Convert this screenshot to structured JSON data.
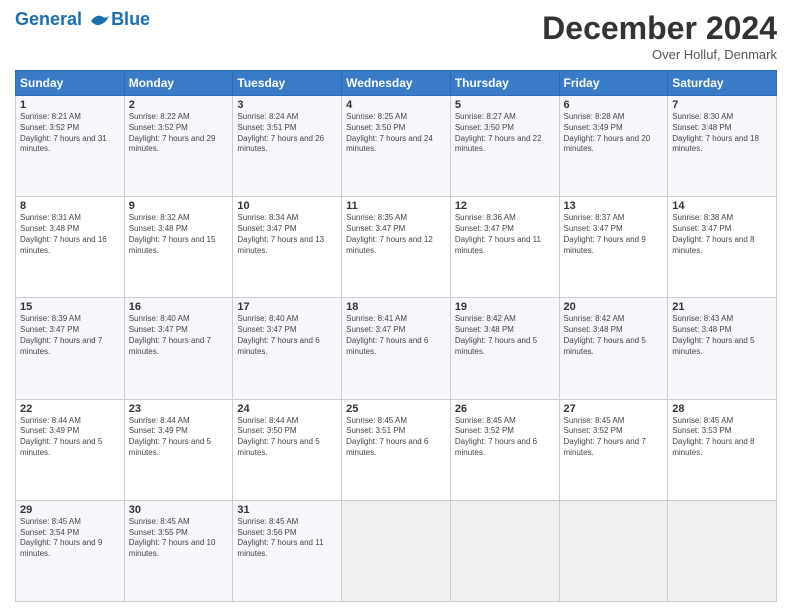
{
  "header": {
    "logo_line1": "General",
    "logo_line2": "Blue",
    "month_title": "December 2024",
    "location": "Over Holluf, Denmark"
  },
  "days_of_week": [
    "Sunday",
    "Monday",
    "Tuesday",
    "Wednesday",
    "Thursday",
    "Friday",
    "Saturday"
  ],
  "weeks": [
    [
      {
        "day": "1",
        "sunrise": "8:21 AM",
        "sunset": "3:52 PM",
        "daylight": "7 hours and 31 minutes."
      },
      {
        "day": "2",
        "sunrise": "8:22 AM",
        "sunset": "3:52 PM",
        "daylight": "7 hours and 29 minutes."
      },
      {
        "day": "3",
        "sunrise": "8:24 AM",
        "sunset": "3:51 PM",
        "daylight": "7 hours and 26 minutes."
      },
      {
        "day": "4",
        "sunrise": "8:25 AM",
        "sunset": "3:50 PM",
        "daylight": "7 hours and 24 minutes."
      },
      {
        "day": "5",
        "sunrise": "8:27 AM",
        "sunset": "3:50 PM",
        "daylight": "7 hours and 22 minutes."
      },
      {
        "day": "6",
        "sunrise": "8:28 AM",
        "sunset": "3:49 PM",
        "daylight": "7 hours and 20 minutes."
      },
      {
        "day": "7",
        "sunrise": "8:30 AM",
        "sunset": "3:48 PM",
        "daylight": "7 hours and 18 minutes."
      }
    ],
    [
      {
        "day": "8",
        "sunrise": "8:31 AM",
        "sunset": "3:48 PM",
        "daylight": "7 hours and 16 minutes."
      },
      {
        "day": "9",
        "sunrise": "8:32 AM",
        "sunset": "3:48 PM",
        "daylight": "7 hours and 15 minutes."
      },
      {
        "day": "10",
        "sunrise": "8:34 AM",
        "sunset": "3:47 PM",
        "daylight": "7 hours and 13 minutes."
      },
      {
        "day": "11",
        "sunrise": "8:35 AM",
        "sunset": "3:47 PM",
        "daylight": "7 hours and 12 minutes."
      },
      {
        "day": "12",
        "sunrise": "8:36 AM",
        "sunset": "3:47 PM",
        "daylight": "7 hours and 11 minutes."
      },
      {
        "day": "13",
        "sunrise": "8:37 AM",
        "sunset": "3:47 PM",
        "daylight": "7 hours and 9 minutes."
      },
      {
        "day": "14",
        "sunrise": "8:38 AM",
        "sunset": "3:47 PM",
        "daylight": "7 hours and 8 minutes."
      }
    ],
    [
      {
        "day": "15",
        "sunrise": "8:39 AM",
        "sunset": "3:47 PM",
        "daylight": "7 hours and 7 minutes."
      },
      {
        "day": "16",
        "sunrise": "8:40 AM",
        "sunset": "3:47 PM",
        "daylight": "7 hours and 7 minutes."
      },
      {
        "day": "17",
        "sunrise": "8:40 AM",
        "sunset": "3:47 PM",
        "daylight": "7 hours and 6 minutes."
      },
      {
        "day": "18",
        "sunrise": "8:41 AM",
        "sunset": "3:47 PM",
        "daylight": "7 hours and 6 minutes."
      },
      {
        "day": "19",
        "sunrise": "8:42 AM",
        "sunset": "3:48 PM",
        "daylight": "7 hours and 5 minutes."
      },
      {
        "day": "20",
        "sunrise": "8:42 AM",
        "sunset": "3:48 PM",
        "daylight": "7 hours and 5 minutes."
      },
      {
        "day": "21",
        "sunrise": "8:43 AM",
        "sunset": "3:48 PM",
        "daylight": "7 hours and 5 minutes."
      }
    ],
    [
      {
        "day": "22",
        "sunrise": "8:44 AM",
        "sunset": "3:49 PM",
        "daylight": "7 hours and 5 minutes."
      },
      {
        "day": "23",
        "sunrise": "8:44 AM",
        "sunset": "3:49 PM",
        "daylight": "7 hours and 5 minutes."
      },
      {
        "day": "24",
        "sunrise": "8:44 AM",
        "sunset": "3:50 PM",
        "daylight": "7 hours and 5 minutes."
      },
      {
        "day": "25",
        "sunrise": "8:45 AM",
        "sunset": "3:51 PM",
        "daylight": "7 hours and 6 minutes."
      },
      {
        "day": "26",
        "sunrise": "8:45 AM",
        "sunset": "3:52 PM",
        "daylight": "7 hours and 6 minutes."
      },
      {
        "day": "27",
        "sunrise": "8:45 AM",
        "sunset": "3:52 PM",
        "daylight": "7 hours and 7 minutes."
      },
      {
        "day": "28",
        "sunrise": "8:45 AM",
        "sunset": "3:53 PM",
        "daylight": "7 hours and 8 minutes."
      }
    ],
    [
      {
        "day": "29",
        "sunrise": "8:45 AM",
        "sunset": "3:54 PM",
        "daylight": "7 hours and 9 minutes."
      },
      {
        "day": "30",
        "sunrise": "8:45 AM",
        "sunset": "3:55 PM",
        "daylight": "7 hours and 10 minutes."
      },
      {
        "day": "31",
        "sunrise": "8:45 AM",
        "sunset": "3:56 PM",
        "daylight": "7 hours and 11 minutes."
      },
      null,
      null,
      null,
      null
    ]
  ]
}
